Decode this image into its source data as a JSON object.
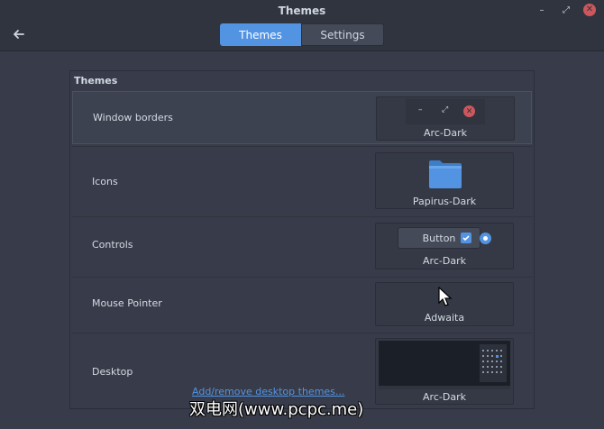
{
  "window": {
    "title": "Themes",
    "minimize": "–",
    "maximize": "⤢",
    "close": "✕"
  },
  "header": {
    "tabs": [
      {
        "label": "Themes",
        "active": true
      },
      {
        "label": "Settings",
        "active": false
      }
    ]
  },
  "panel": {
    "title": "Themes",
    "rows": [
      {
        "label": "Window borders",
        "value": "Arc-Dark",
        "selected": true
      },
      {
        "label": "Icons",
        "value": "Papirus-Dark"
      },
      {
        "label": "Controls",
        "value": "Arc-Dark",
        "button_label": "Button"
      },
      {
        "label": "Mouse Pointer",
        "value": "Adwaita"
      },
      {
        "label": "Desktop",
        "value": "Arc-Dark"
      }
    ]
  },
  "footer": {
    "add_link": "Add/remove desktop themes..."
  },
  "watermark": "双电网(www.pcpc.me)",
  "colors": {
    "accent": "#5294e2",
    "close": "#cc575d",
    "background": "#383c4a"
  }
}
